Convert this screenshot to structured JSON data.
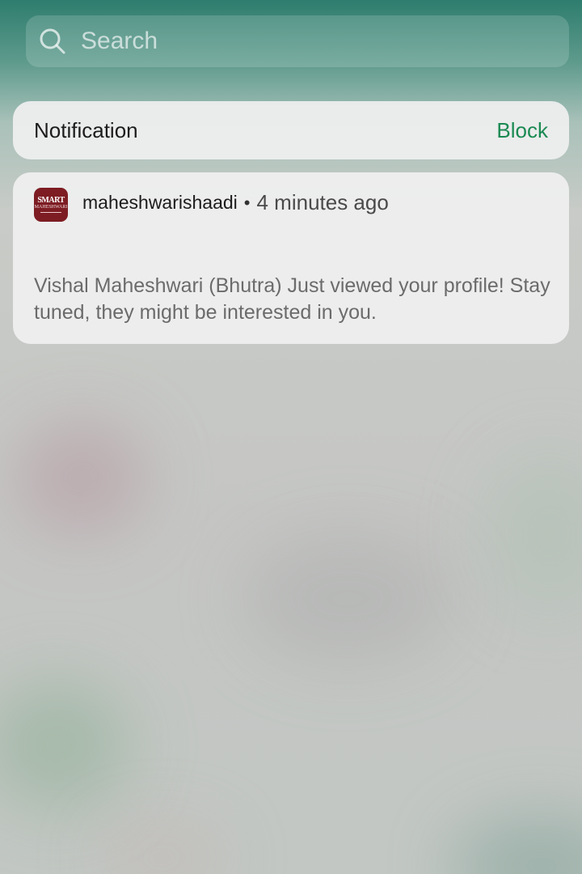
{
  "search": {
    "placeholder": "Search",
    "icon": "search-icon"
  },
  "notification_header": {
    "title": "Notification",
    "block_label": "Block",
    "block_color": "#1a8a52"
  },
  "notification": {
    "app_icon": {
      "name": "app-logo-icon",
      "line1": "SMART",
      "line2": "MAHESHWARI",
      "color": "#7d1c23"
    },
    "app_name": "maheshwarishaadi",
    "separator": "•",
    "time": "4 minutes ago",
    "message": "Vishal Maheshwari (Bhutra) Just viewed your profile! Stay tuned, they might be interested in you."
  }
}
